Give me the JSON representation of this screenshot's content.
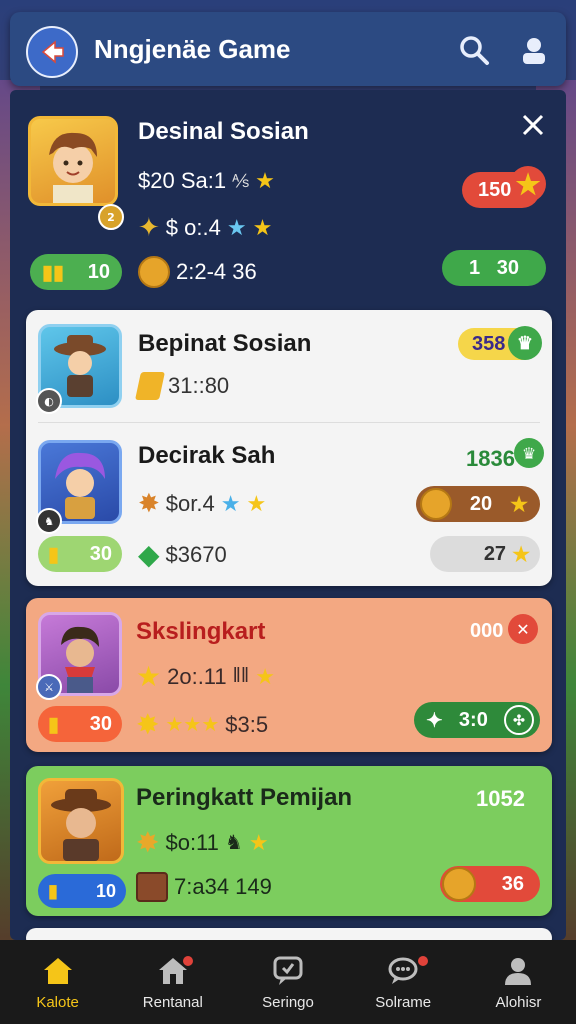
{
  "header": {
    "title": "Nngjenäe Game"
  },
  "top_card": {
    "name": "Desinal Sosian",
    "line1": "$20 Sa:1",
    "line2": "$ o:.4",
    "line3": "2:2-4 36",
    "left_pill": "10",
    "right_pill": "1   30",
    "badge": "150",
    "avatar_level": "2"
  },
  "cards": [
    {
      "name": "Bepinat Sosian",
      "line1": "31::80",
      "score": "358"
    },
    {
      "name": "Decirak Sah",
      "line1": "$or.4",
      "line2": "$3670",
      "score": "1836",
      "left_pill": "30",
      "coin_pill": "20",
      "right_pill": "27"
    },
    {
      "name": "Skslingkart",
      "line1": "2o:.11",
      "line2": "$3:5",
      "score": "000",
      "left_pill": "30",
      "right_pill": "3:0"
    },
    {
      "name": "Peringkatt Pemijan",
      "line1": "$o:11",
      "line2": "7:a34 149",
      "score": "1052",
      "right_pill": "36",
      "badge": "10"
    }
  ],
  "nav": [
    {
      "label": "Kalote",
      "icon": "home-icon",
      "active": true
    },
    {
      "label": "Rentanal",
      "icon": "house-alert-icon",
      "active": false
    },
    {
      "label": "Seringo",
      "icon": "chat-icon",
      "active": false
    },
    {
      "label": "Solrame",
      "icon": "message-icon",
      "active": false
    },
    {
      "label": "Alohisr",
      "icon": "user-icon",
      "active": false
    }
  ],
  "colors": {
    "header_bg": "#2c4a82",
    "panel_bg": "#1d2c52",
    "card_white": "#f4f4f4",
    "card_salmon": "#f3a882",
    "card_green": "#7ccd5e",
    "nav_bg": "#1a1a1a",
    "nav_active": "#f5c518"
  }
}
